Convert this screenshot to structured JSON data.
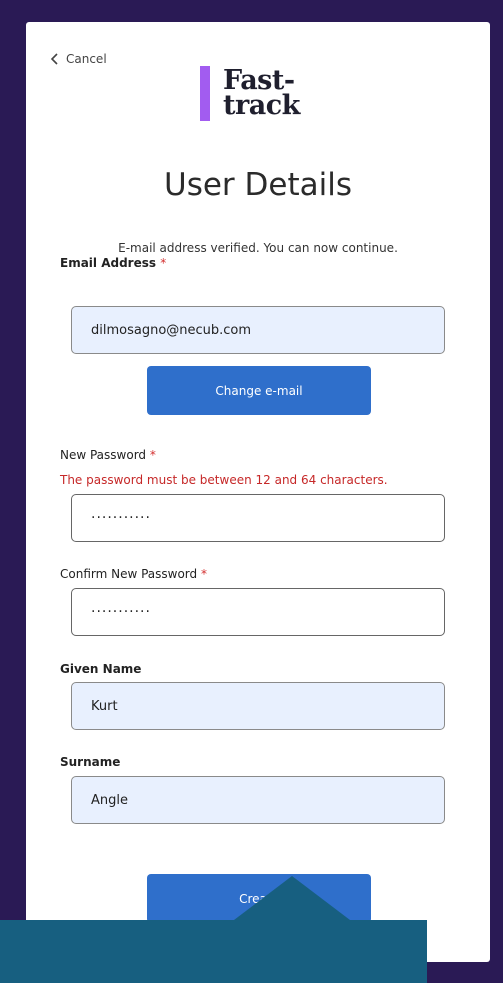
{
  "cancel": {
    "label": "Cancel",
    "icon": "chevron-left-icon"
  },
  "logo": {
    "line1": "Fast-",
    "line2": "track",
    "bar_color": "#a25cf0"
  },
  "page_title": "User Details",
  "verified_message": "E-mail address verified. You can now continue.",
  "email": {
    "label": "Email Address",
    "required": "*",
    "value": "dilmosagno@necub.com"
  },
  "change_email_button": "Change e-mail",
  "new_password": {
    "label": "New Password",
    "required": "*",
    "error": "The password must be between 12 and 64 characters.",
    "value": "···········"
  },
  "confirm_password": {
    "label": "Confirm New Password",
    "required": "*",
    "value": "···········"
  },
  "given_name": {
    "label": "Given Name",
    "value": "Kurt"
  },
  "surname": {
    "label": "Surname",
    "value": "Angle"
  },
  "create_button": "Create",
  "colors": {
    "background": "#2a1a55",
    "accent": "#2f6fcb",
    "error": "#c62828",
    "tooltip": "#175f80",
    "field_fill": "#e8f0fe"
  }
}
